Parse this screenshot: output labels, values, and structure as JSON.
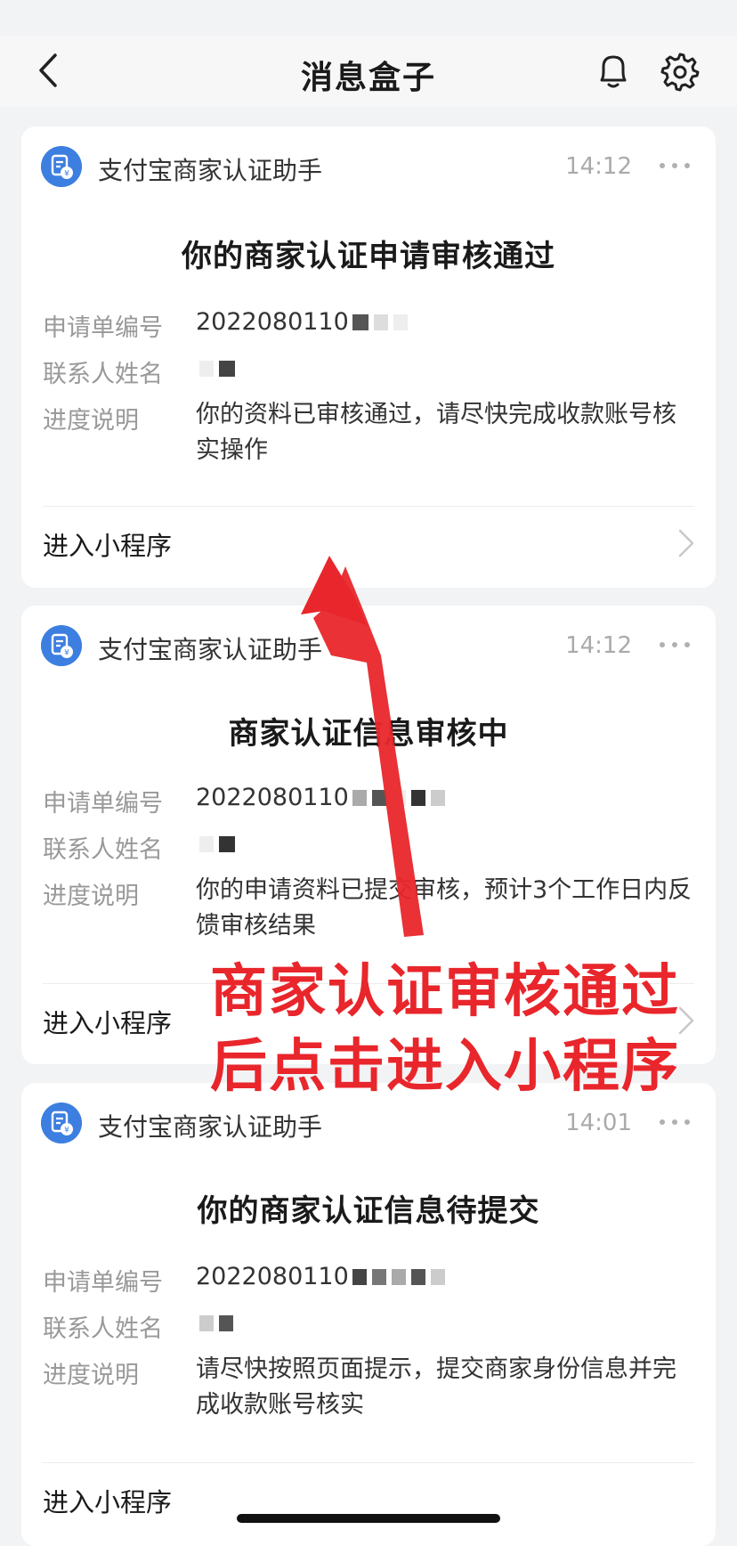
{
  "nav": {
    "title": "消息盒子",
    "back_icon": "chevron-left-icon",
    "bell_icon": "bell-icon",
    "settings_icon": "gear-icon"
  },
  "messages": [
    {
      "app_name": "支付宝商家认证助手",
      "time": "14:12",
      "title": "你的商家认证申请审核通过",
      "rows": [
        {
          "label": "申请单编号",
          "value": "2022080110"
        },
        {
          "label": "联系人姓名",
          "value": ""
        },
        {
          "label": "进度说明",
          "value": "你的资料已审核通过，请尽快完成收款账号核实操作"
        }
      ],
      "action": "进入小程序"
    },
    {
      "app_name": "支付宝商家认证助手",
      "time": "14:12",
      "title": "商家认证信息审核中",
      "rows": [
        {
          "label": "申请单编号",
          "value": "2022080110"
        },
        {
          "label": "联系人姓名",
          "value": ""
        },
        {
          "label": "进度说明",
          "value": "你的申请资料已提交审核，预计3个工作日内反馈审核结果"
        }
      ],
      "action": "进入小程序"
    },
    {
      "app_name": "支付宝商家认证助手",
      "time": "14:01",
      "title": "你的商家认证信息待提交",
      "rows": [
        {
          "label": "申请单编号",
          "value": "2022080110"
        },
        {
          "label": "联系人姓名",
          "value": ""
        },
        {
          "label": "进度说明",
          "value": "请尽快按照页面提示，提交商家身份信息并完成收款账号核实"
        }
      ],
      "action": "进入小程序"
    }
  ],
  "annotation": {
    "line1": "商家认证审核通过",
    "line2": "后点击进入小程序",
    "color": "#e8262b"
  },
  "colors": {
    "accent": "#3d7fe0",
    "background": "#f2f3f5"
  }
}
